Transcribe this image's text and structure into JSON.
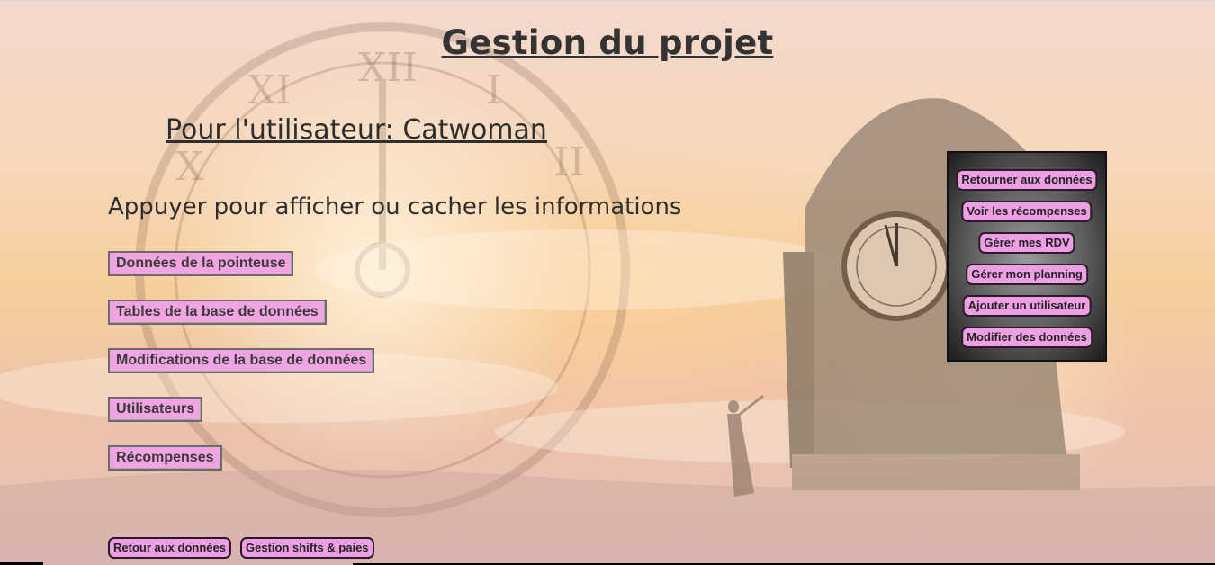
{
  "page": {
    "title": "Gestion du projet",
    "user_title": "Pour l'utilisateur: Catwoman",
    "subtitle": "Appuyer pour afficher ou cacher les informations"
  },
  "toggles": [
    {
      "label": "Données de la pointeuse"
    },
    {
      "label": "Tables de la base de données"
    },
    {
      "label": "Modifications de la base de données"
    },
    {
      "label": "Utilisateurs"
    },
    {
      "label": "Récompenses"
    }
  ],
  "bottom_nav": [
    {
      "label": "Retour aux données"
    },
    {
      "label": "Gestion shifts & paies"
    }
  ],
  "side_menu": [
    {
      "label": "Retourner aux données"
    },
    {
      "label": "Voir les récompenses"
    },
    {
      "label": "Gérer mes RDV"
    },
    {
      "label": "Gérer mon planning"
    },
    {
      "label": "Ajouter un utilisateur"
    },
    {
      "label": "Modifier des données"
    }
  ],
  "colors": {
    "button_pink": "#f0a5e2",
    "panel_dark": "#1c1c1c"
  },
  "icons": {
    "background": "clock-fantasy-illustration"
  }
}
